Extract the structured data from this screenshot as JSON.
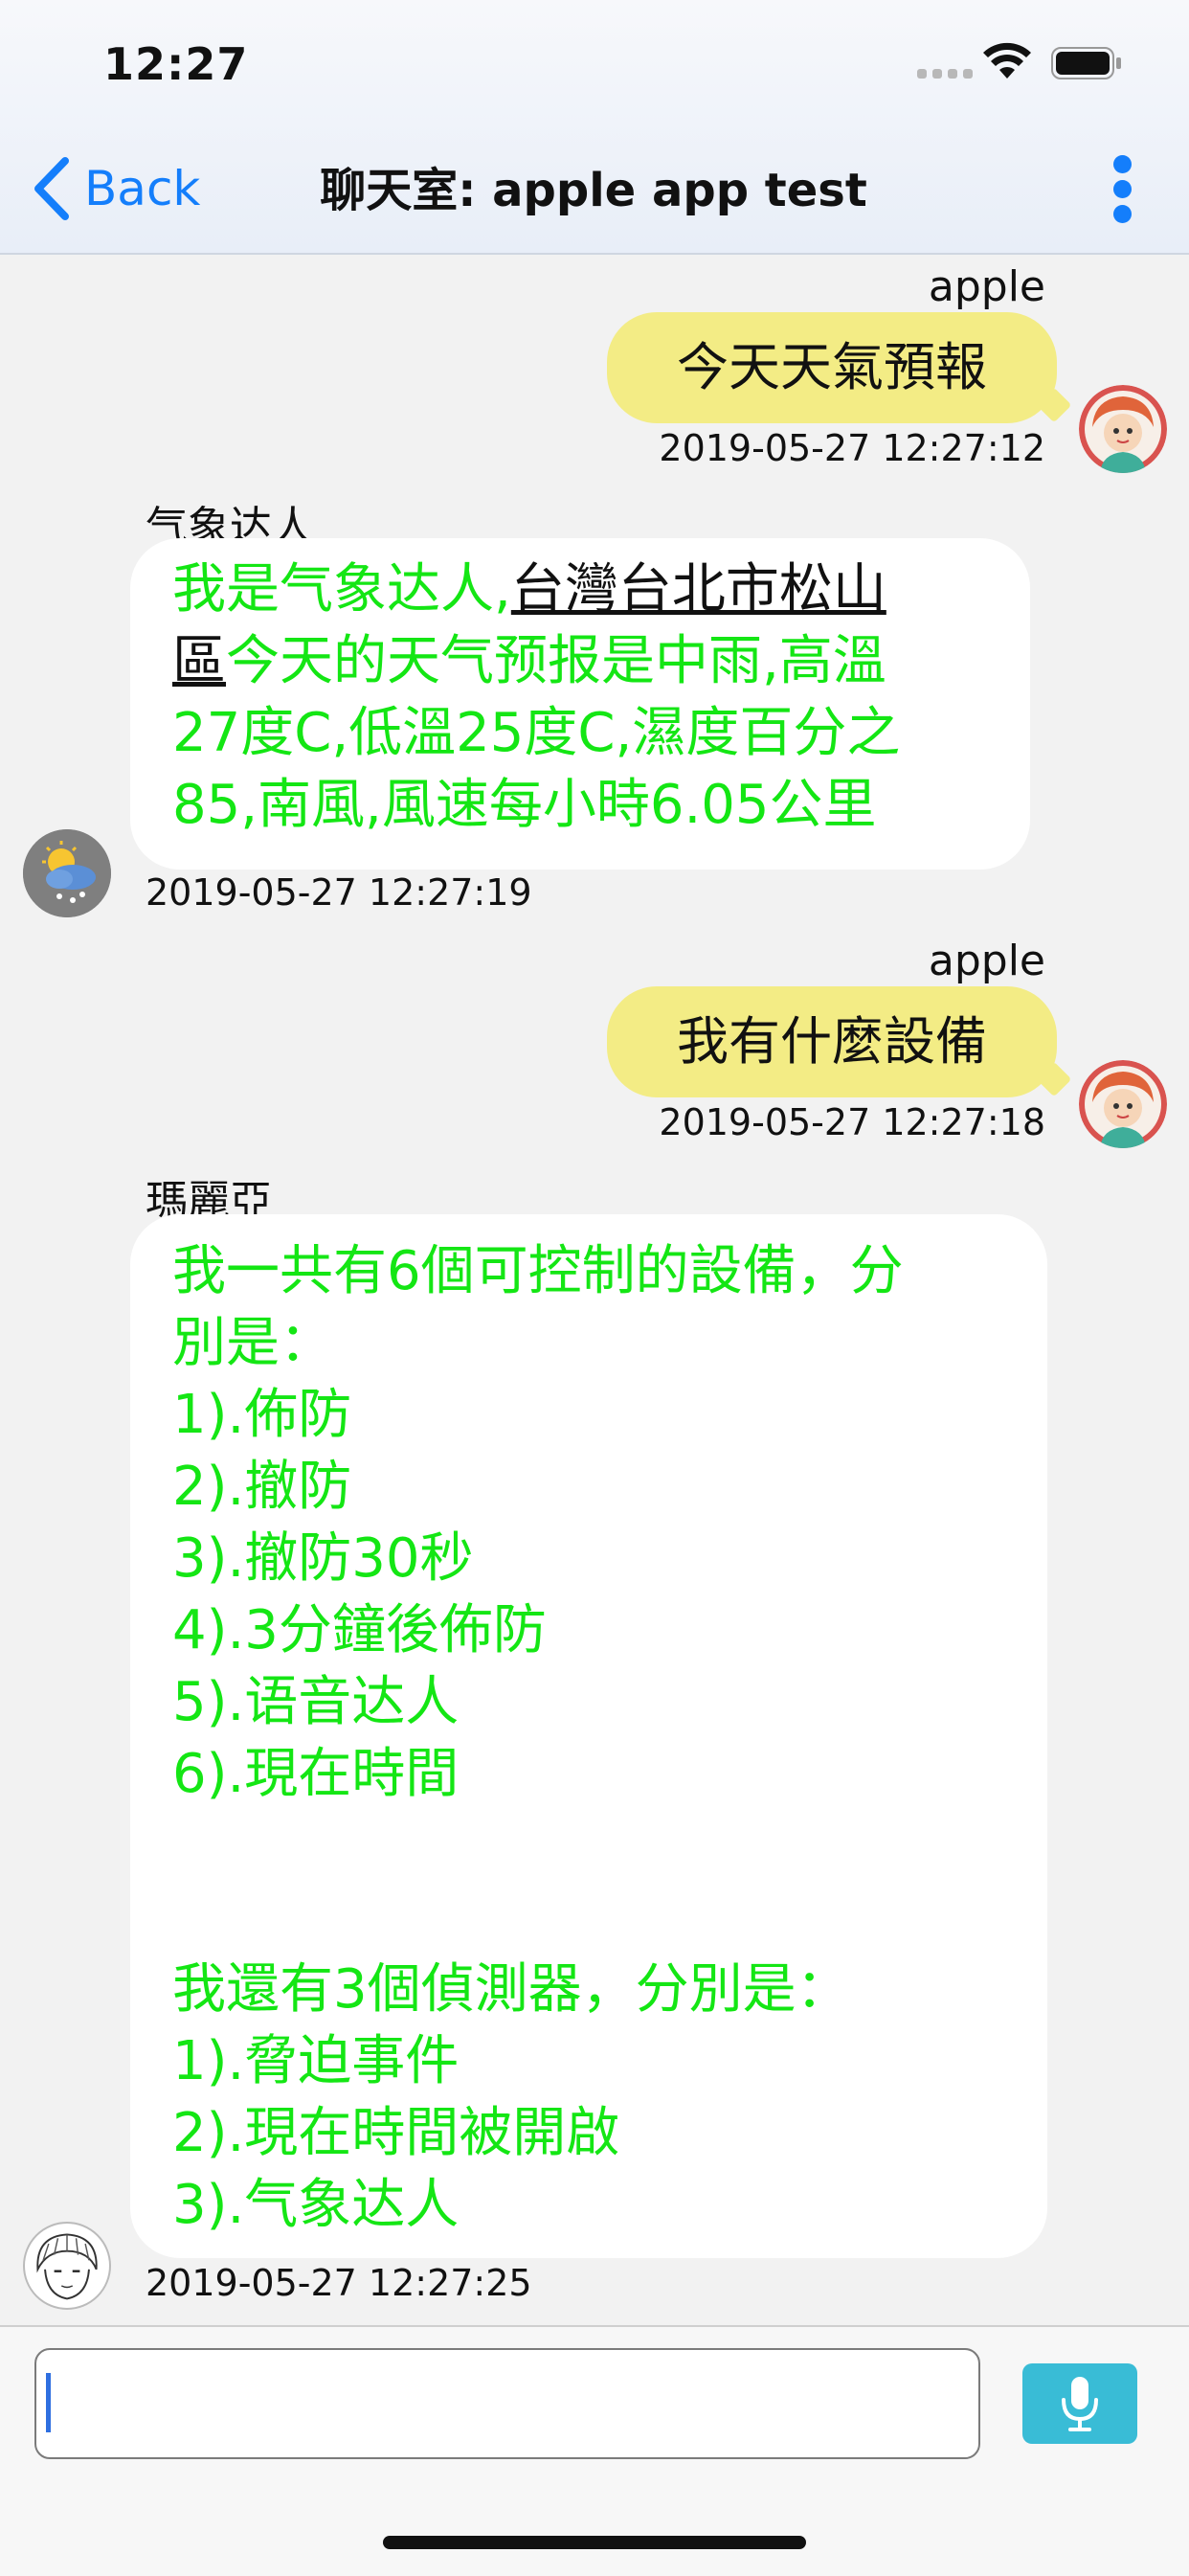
{
  "status": {
    "time": "12:27"
  },
  "nav": {
    "back_label": "Back",
    "title": "聊天室: apple app test"
  },
  "messages": [
    {
      "sender": "apple",
      "text": "今天天氣預報",
      "timestamp": "2019-05-27 12:27:12"
    },
    {
      "sender": "气象达人",
      "line1_a": "我是气象达人,",
      "line1_link": "台灣台北市松山",
      "line2_link": "區",
      "line2_b": "今天的天气预报是中雨,高溫",
      "line3": "27度C,低溫25度C,濕度百分之",
      "line4": "85,南風,風速每小時6.05公里",
      "timestamp": "2019-05-27 12:27:19"
    },
    {
      "sender": "apple",
      "text": "我有什麼設備",
      "timestamp": "2019-05-27 12:27:18"
    },
    {
      "sender": "瑪麗亞",
      "lines": [
        "我一共有6個可控制的設備，分",
        "別是：",
        "1).佈防",
        "2).撤防",
        "3).撤防30秒",
        "4).3分鐘後佈防",
        "5).语音达人",
        "6).現在時間",
        "",
        "",
        "我還有3個偵測器，分別是：",
        "1).脅迫事件",
        "2).現在時間被開啟",
        "3).气象达人"
      ],
      "timestamp": "2019-05-27 12:27:25"
    }
  ],
  "input": {
    "value": ""
  },
  "colors": {
    "accent": "#147efb",
    "bot_text": "#14e614",
    "my_bubble": "#f3ec85",
    "mic_button": "#39bcd6"
  }
}
